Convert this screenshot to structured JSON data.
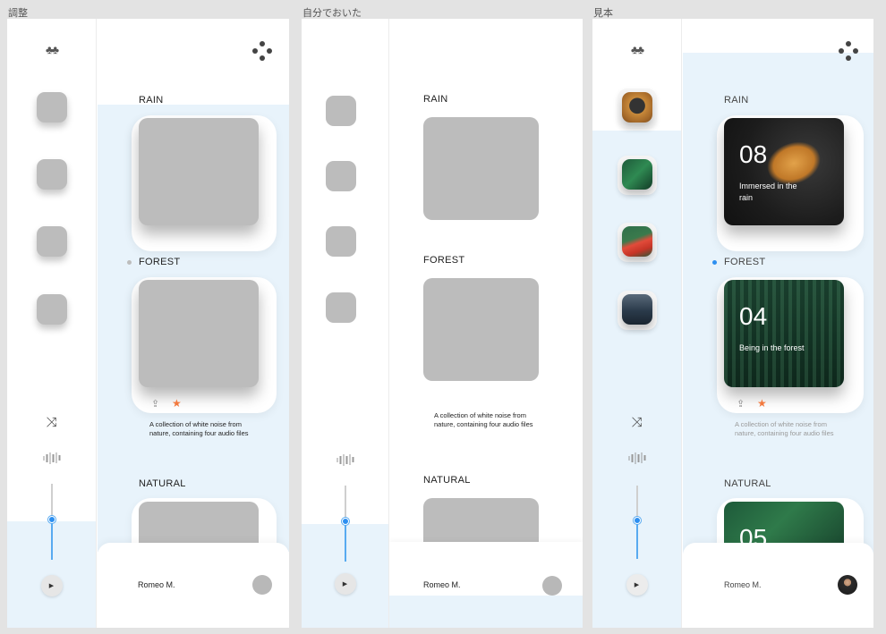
{
  "boards": [
    {
      "title": "調整"
    },
    {
      "title": "自分でおいた"
    },
    {
      "title": "見本"
    }
  ],
  "sections": {
    "rain": "RAIN",
    "forest": "FOREST",
    "natural": "NATURAL"
  },
  "cards": {
    "rain": {
      "number": "08",
      "caption": "Immersed in the rain"
    },
    "forest": {
      "number": "04",
      "caption": "Being in the forest"
    },
    "natural": {
      "number": "05"
    }
  },
  "description": "A collection of white noise from nature, containing four audio files",
  "user": {
    "name": "Romeo M."
  },
  "icons": {
    "logo": "trees-icon",
    "menu": "four-dots-menu-icon",
    "shuffle": "shuffle-icon",
    "wave": "sound-wave-icon",
    "play": "play-icon",
    "share": "share-icon",
    "favorite": "star-icon"
  },
  "glyphs": {
    "logo": "♣♣",
    "shuffle": "⤨",
    "play": "▶",
    "share": "⇪",
    "star": "★"
  },
  "colors": {
    "accent": "#2d8ff0",
    "favorite": "#f2793e",
    "panel_blue": "#e8f3fb",
    "placeholder": "#bcbcbc"
  },
  "volume": 0.35
}
